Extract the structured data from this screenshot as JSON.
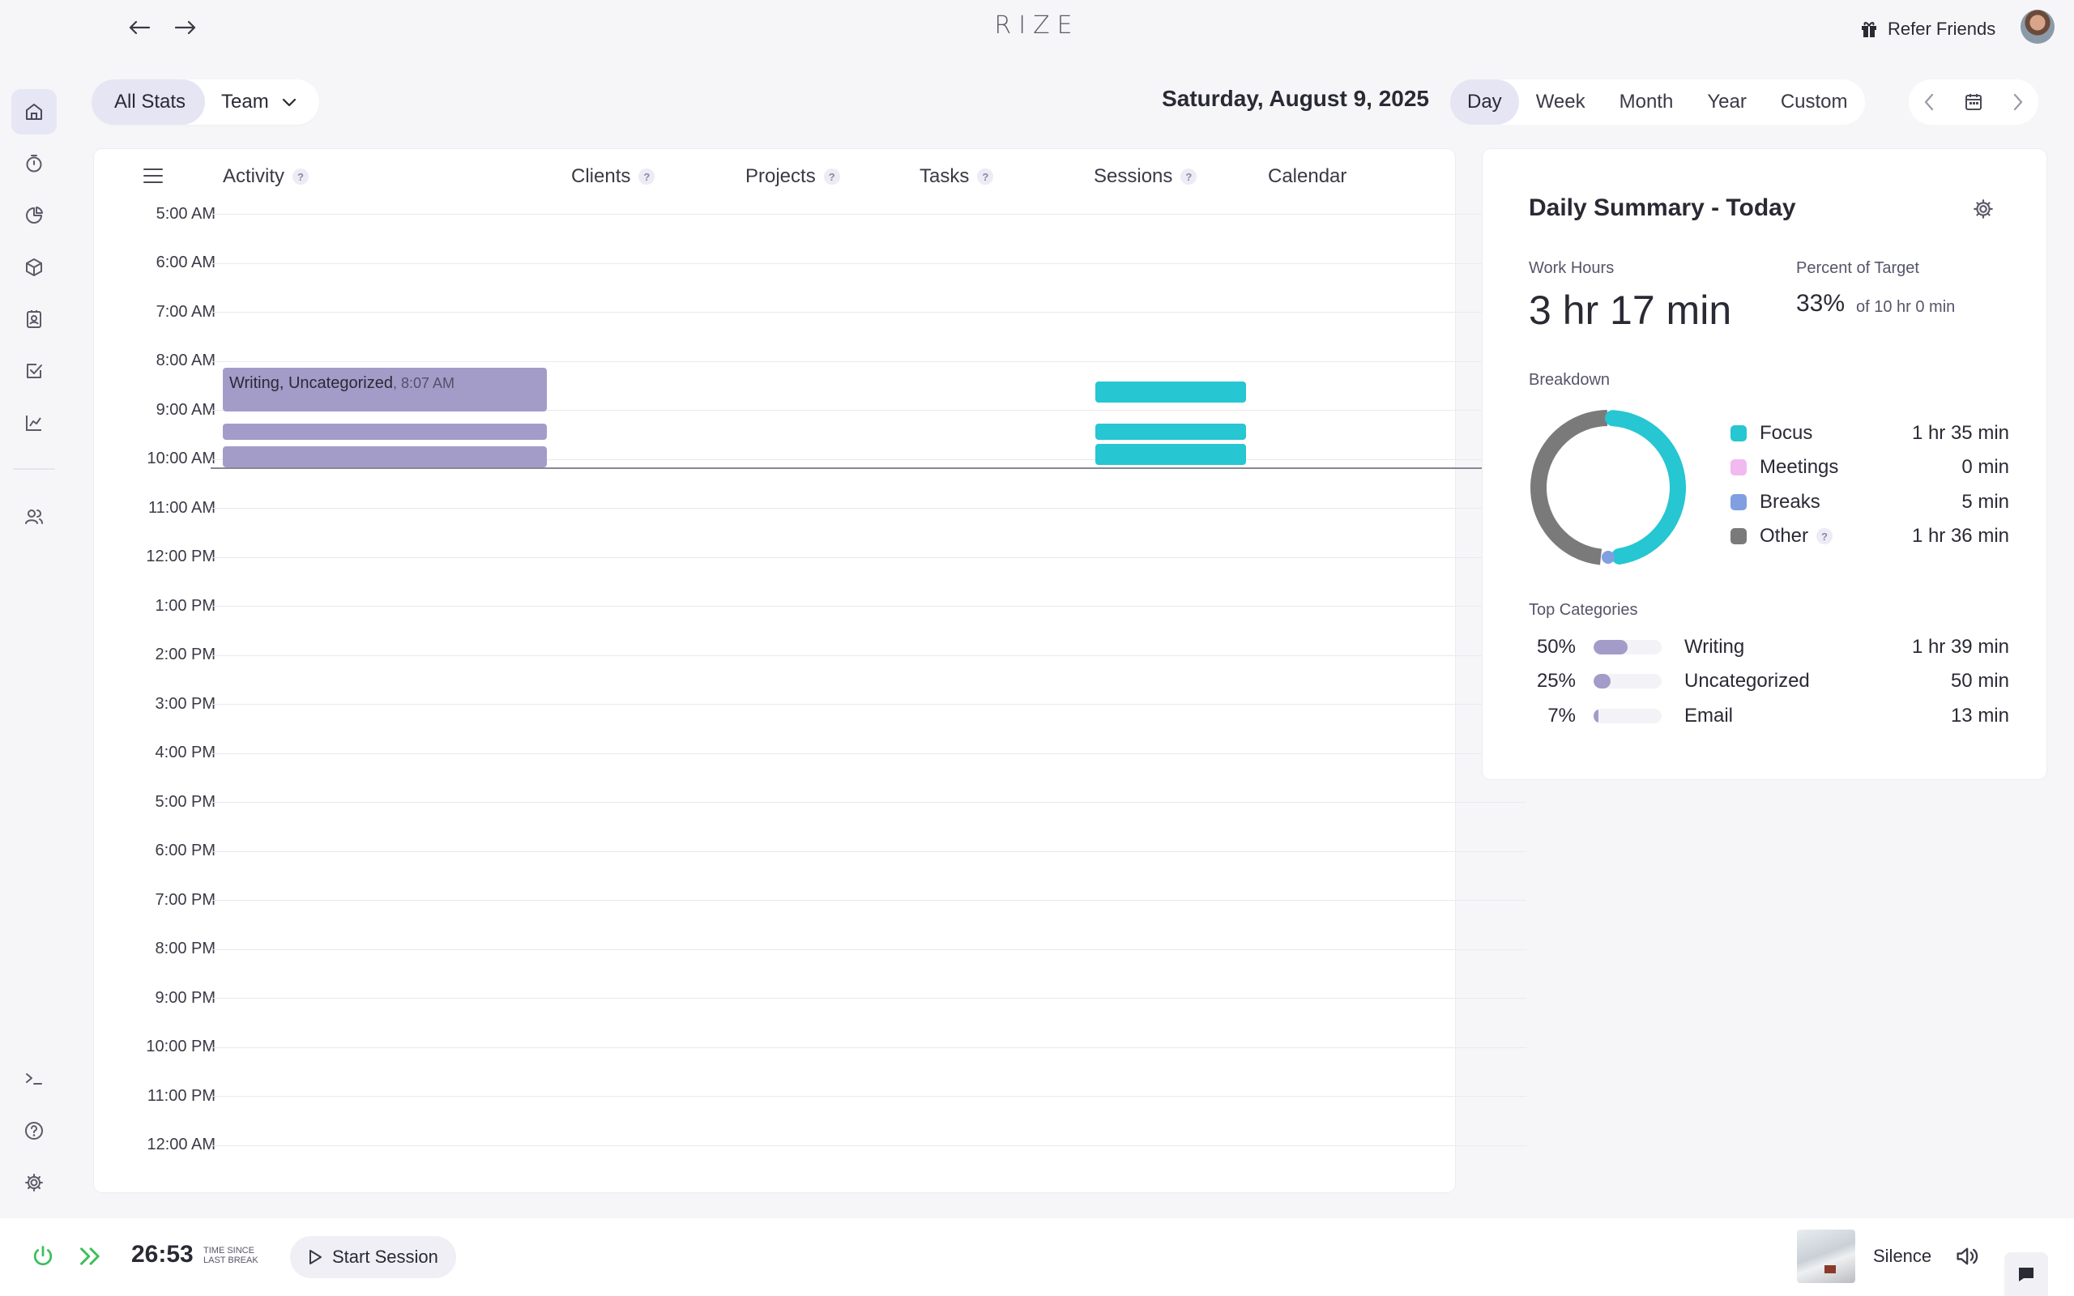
{
  "app": {
    "brand": "RIZE"
  },
  "topbar": {
    "refer_label": "Refer Friends"
  },
  "filters": {
    "all_stats": "All Stats",
    "team": "Team"
  },
  "date": "Saturday, August 9, 2025",
  "range_tabs": [
    {
      "label": "Day",
      "active": true
    },
    {
      "label": "Week"
    },
    {
      "label": "Month"
    },
    {
      "label": "Year"
    },
    {
      "label": "Custom"
    }
  ],
  "timeline": {
    "columns": {
      "activity": "Activity",
      "clients": "Clients",
      "projects": "Projects",
      "tasks": "Tasks",
      "sessions": "Sessions",
      "calendar": "Calendar"
    },
    "hours": [
      "5:00 AM",
      "6:00 AM",
      "7:00 AM",
      "8:00 AM",
      "9:00 AM",
      "10:00 AM",
      "11:00 AM",
      "12:00 PM",
      "1:00 PM",
      "2:00 PM",
      "3:00 PM",
      "4:00 PM",
      "5:00 PM",
      "6:00 PM",
      "7:00 PM",
      "8:00 PM",
      "9:00 PM",
      "10:00 PM",
      "11:00 PM",
      "12:00 AM"
    ],
    "activity_label": "Writing, Uncategorized",
    "activity_time": ", 8:07 AM"
  },
  "summary": {
    "title": "Daily Summary - Today",
    "work_hours_label": "Work Hours",
    "work_hours_value": "3 hr 17 min",
    "percent_label": "Percent of Target",
    "percent_value": "33%",
    "percent_sub": "of 10 hr 0 min",
    "breakdown_label": "Breakdown",
    "breakdown": [
      {
        "name": "Focus",
        "value": "1 hr 35 min",
        "color": "#26c6d2"
      },
      {
        "name": "Meetings",
        "value": "0 min",
        "color": "#f2b8f0"
      },
      {
        "name": "Breaks",
        "value": "5 min",
        "color": "#7f9fe0"
      },
      {
        "name": "Other",
        "value": "1 hr 36 min",
        "color": "#7a7a7a"
      }
    ],
    "top_categories_label": "Top Categories",
    "top_categories": [
      {
        "pct": "50%",
        "name": "Writing",
        "value": "1 hr 39 min",
        "fill": 0.5
      },
      {
        "pct": "25%",
        "name": "Uncategorized",
        "value": "50 min",
        "fill": 0.25
      },
      {
        "pct": "7%",
        "name": "Email",
        "value": "13 min",
        "fill": 0.07
      }
    ]
  },
  "bottombar": {
    "timer": "26:53",
    "timer_caption_1": "TIME SINCE",
    "timer_caption_2": "LAST BREAK",
    "start_session": "Start Session",
    "sound_label": "Silence"
  }
}
